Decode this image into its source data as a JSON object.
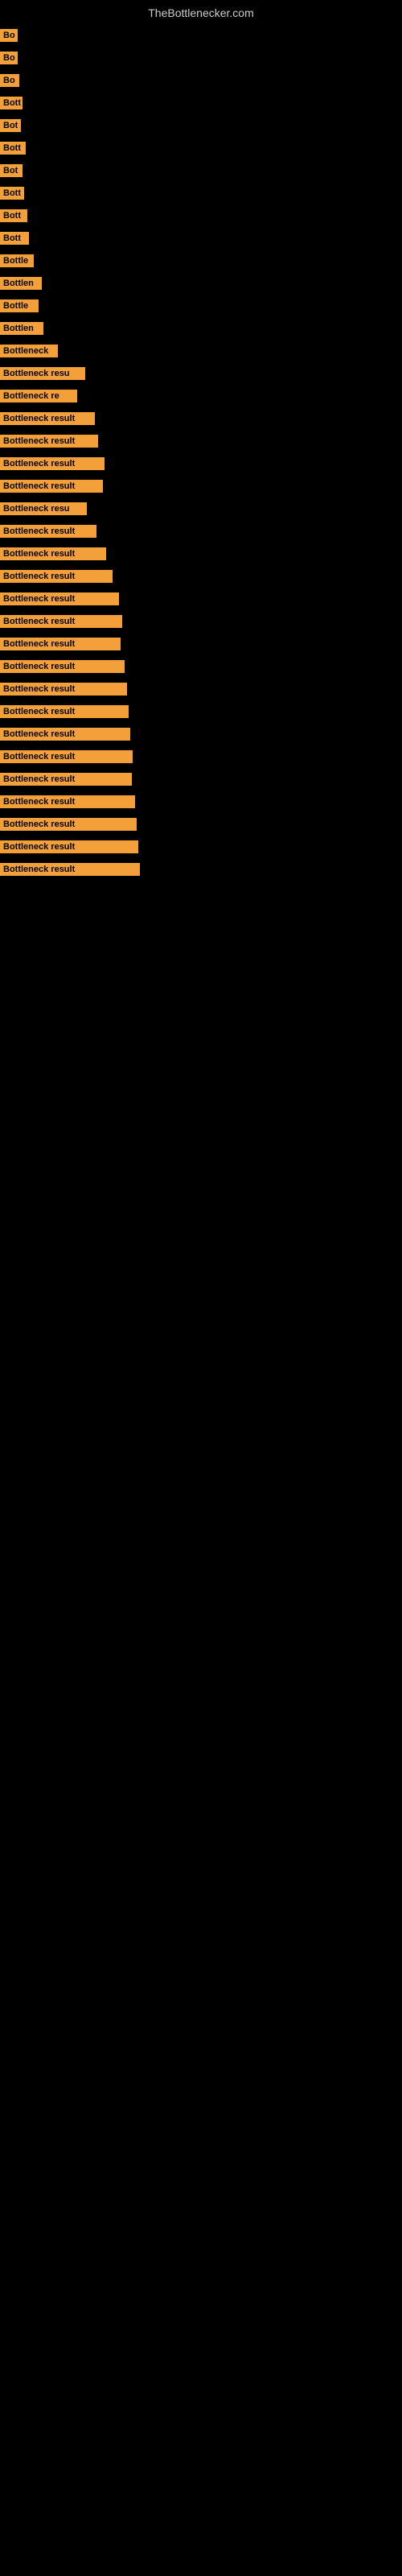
{
  "site": {
    "title": "TheBottlenecker.com"
  },
  "bars": [
    {
      "label": "Bo",
      "width": 22
    },
    {
      "label": "Bo",
      "width": 22
    },
    {
      "label": "Bo",
      "width": 24
    },
    {
      "label": "Bott",
      "width": 28
    },
    {
      "label": "Bot",
      "width": 26
    },
    {
      "label": "Bott",
      "width": 32
    },
    {
      "label": "Bot",
      "width": 28
    },
    {
      "label": "Bott",
      "width": 30
    },
    {
      "label": "Bott",
      "width": 34
    },
    {
      "label": "Bott",
      "width": 36
    },
    {
      "label": "Bottle",
      "width": 42
    },
    {
      "label": "Bottlen",
      "width": 52
    },
    {
      "label": "Bottle",
      "width": 48
    },
    {
      "label": "Bottlen",
      "width": 54
    },
    {
      "label": "Bottleneck",
      "width": 72
    },
    {
      "label": "Bottleneck resu",
      "width": 106
    },
    {
      "label": "Bottleneck re",
      "width": 96
    },
    {
      "label": "Bottleneck result",
      "width": 118
    },
    {
      "label": "Bottleneck result",
      "width": 122
    },
    {
      "label": "Bottleneck result",
      "width": 130
    },
    {
      "label": "Bottleneck result",
      "width": 128
    },
    {
      "label": "Bottleneck resu",
      "width": 108
    },
    {
      "label": "Bottleneck result",
      "width": 120
    },
    {
      "label": "Bottleneck result",
      "width": 132
    },
    {
      "label": "Bottleneck result",
      "width": 140
    },
    {
      "label": "Bottleneck result",
      "width": 148
    },
    {
      "label": "Bottleneck result",
      "width": 152
    },
    {
      "label": "Bottleneck result",
      "width": 150
    },
    {
      "label": "Bottleneck result",
      "width": 155
    },
    {
      "label": "Bottleneck result",
      "width": 158
    },
    {
      "label": "Bottleneck result",
      "width": 160
    },
    {
      "label": "Bottleneck result",
      "width": 162
    },
    {
      "label": "Bottleneck result",
      "width": 165
    },
    {
      "label": "Bottleneck result",
      "width": 164
    },
    {
      "label": "Bottleneck result",
      "width": 168
    },
    {
      "label": "Bottleneck result",
      "width": 170
    },
    {
      "label": "Bottleneck result",
      "width": 172
    },
    {
      "label": "Bottleneck result",
      "width": 174
    }
  ]
}
